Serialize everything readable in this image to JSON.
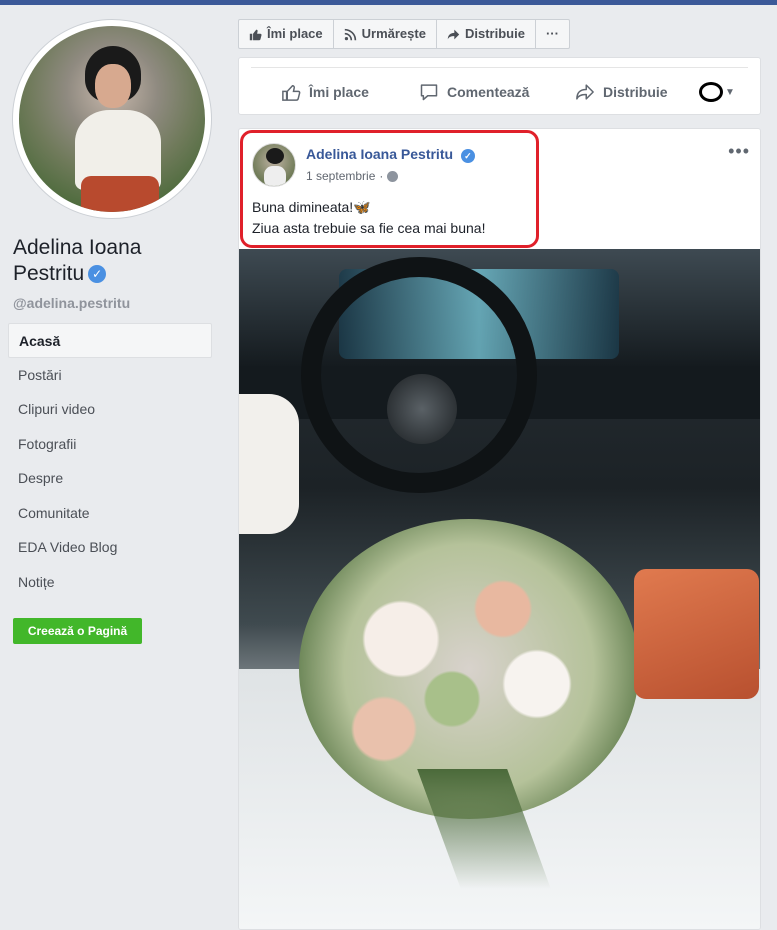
{
  "profile": {
    "name": "Adelina Ioana Pestritu",
    "handle": "@adelina.pestritu"
  },
  "nav": {
    "items": [
      {
        "label": "Acasă"
      },
      {
        "label": "Postări"
      },
      {
        "label": "Clipuri video"
      },
      {
        "label": "Fotografii"
      },
      {
        "label": "Despre"
      },
      {
        "label": "Comunitate"
      },
      {
        "label": "EDA Video Blog"
      },
      {
        "label": "Notițe"
      }
    ],
    "create_page": "Creează o Pagină"
  },
  "toolbar": {
    "like": "Îmi place",
    "follow": "Urmărește",
    "share": "Distribuie",
    "more": "···"
  },
  "actions": {
    "like": "Îmi place",
    "comment": "Comentează",
    "share": "Distribuie"
  },
  "post": {
    "author": "Adelina Ioana Pestritu",
    "date": "1 septembrie",
    "line1": "Buna dimineata!🦋",
    "line2": "Ziua asta trebuie sa fie cea mai buna!",
    "more": "•••"
  },
  "colors": {
    "facebook_blue": "#3b5998",
    "link_blue": "#385898",
    "create_green": "#42b72a",
    "highlight_red": "#e0202a",
    "verified_blue": "#4a90e2"
  },
  "icons": {
    "verified": "verified-badge-icon",
    "like": "thumbs-up-icon",
    "follow": "rss-icon",
    "share": "share-arrow-icon",
    "comment": "comment-bubble-icon",
    "privacy": "globe-icon"
  }
}
